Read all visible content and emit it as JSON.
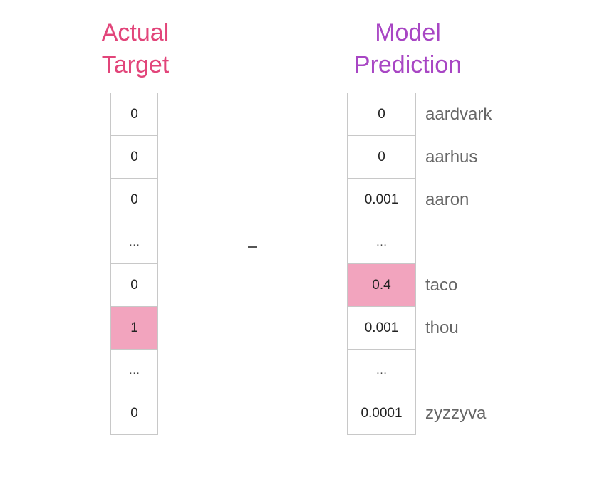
{
  "titles": {
    "actual_target": [
      "Actual",
      "Target"
    ],
    "model_prediction": [
      "Model",
      "Prediction"
    ]
  },
  "colors": {
    "actual_title": "#e2457a",
    "model_title": "#a846c4",
    "highlight": "#f2a4be"
  },
  "operator": "-",
  "actual_target": [
    "0",
    "0",
    "0",
    "…",
    "0",
    "1",
    "…",
    "0"
  ],
  "model_prediction": [
    "0",
    "0",
    "0.001",
    "…",
    "0.4",
    "0.001",
    "…",
    "0.0001"
  ],
  "vocabulary": [
    "aardvark",
    "aarhus",
    "aaron",
    "",
    "taco",
    "thou",
    "",
    "zyzzyva"
  ],
  "highlight_rows": {
    "actual_target": 5,
    "model_prediction": 4
  }
}
